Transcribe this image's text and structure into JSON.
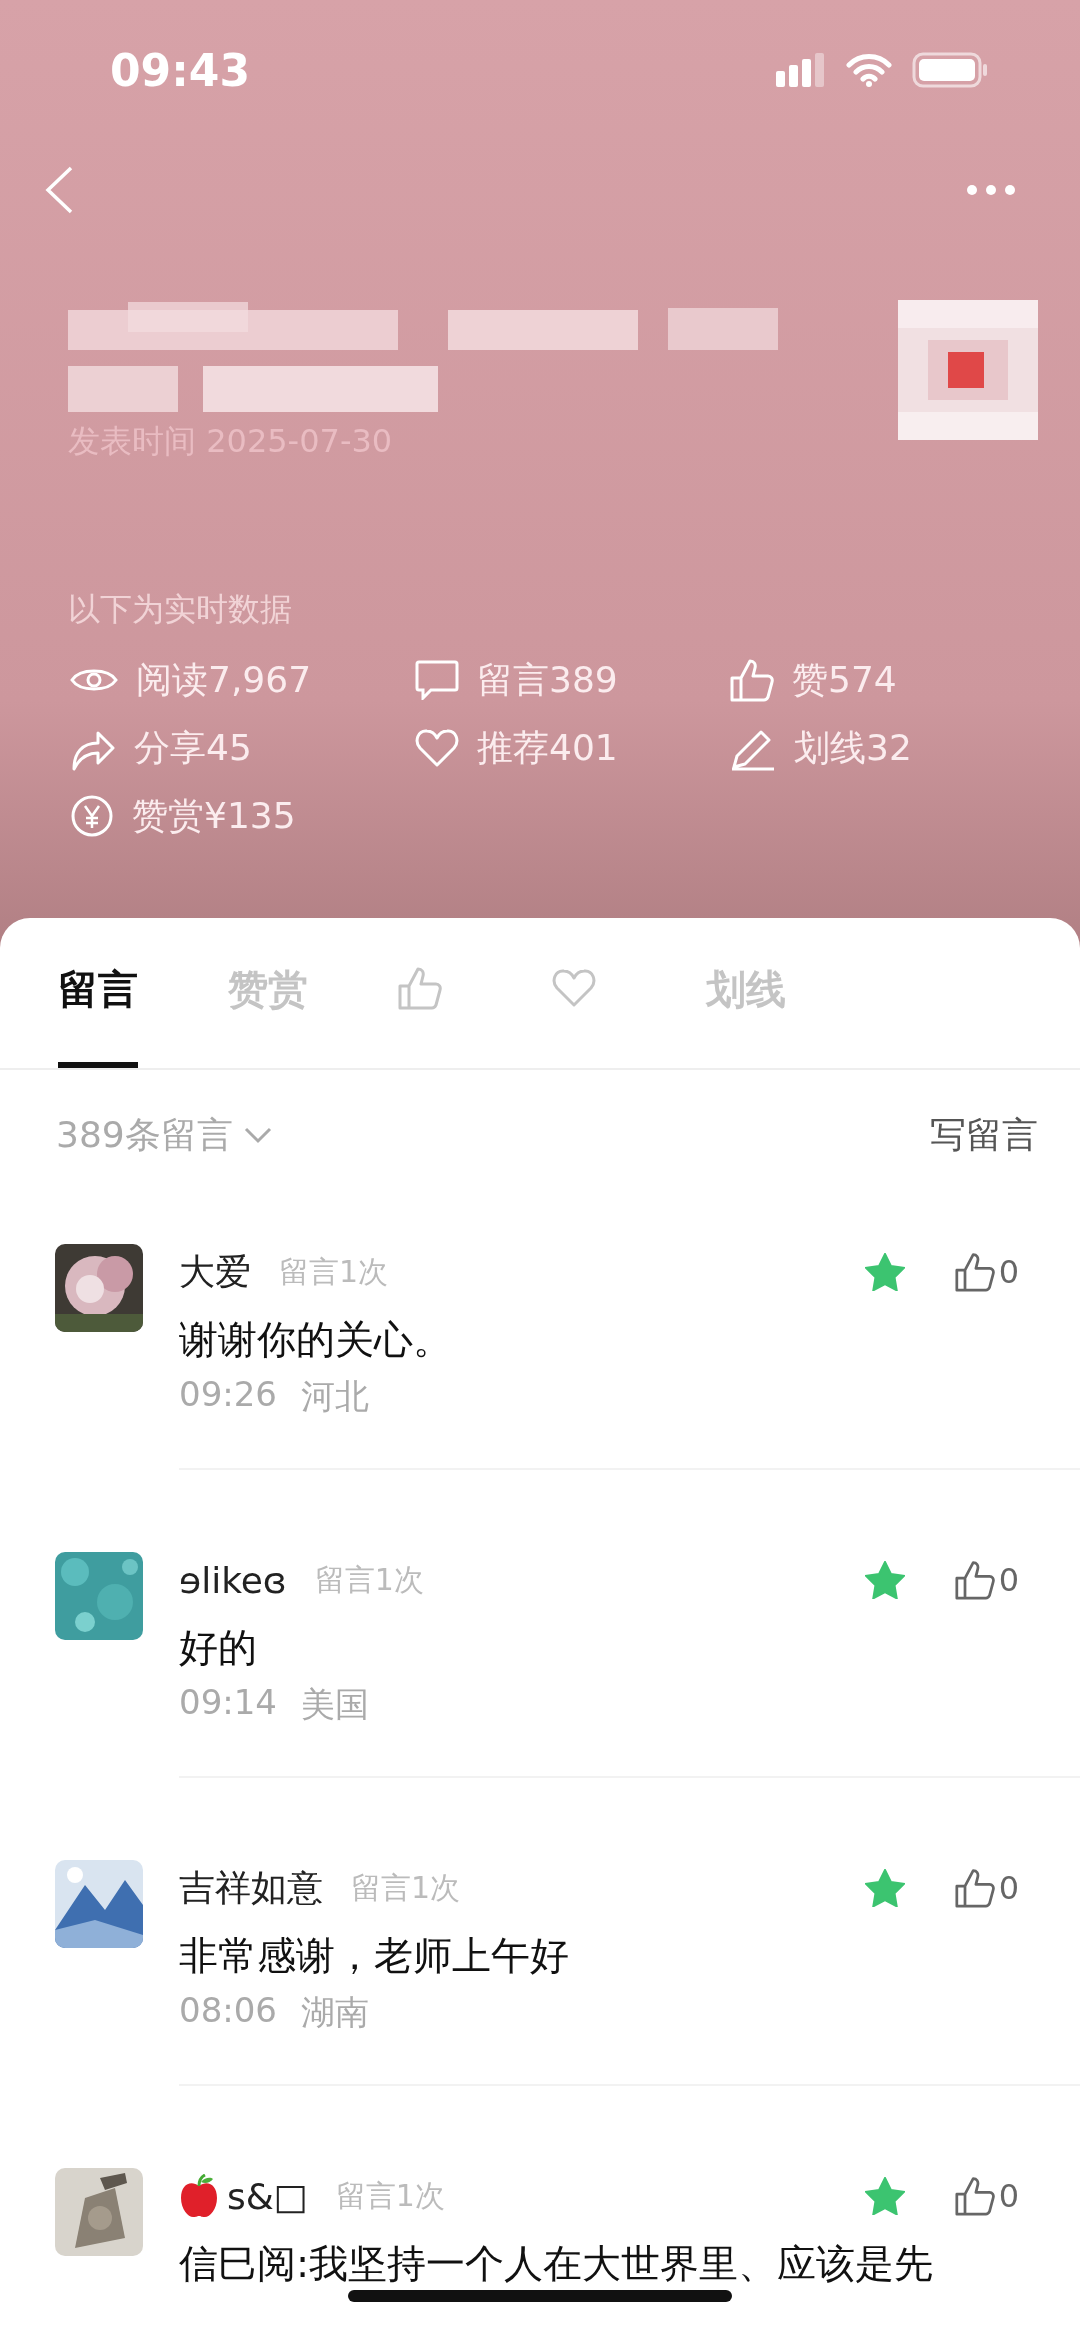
{
  "status_bar": {
    "time": "09:43"
  },
  "article": {
    "published": "发表时间 2025-07-30"
  },
  "realtime_label": "以下为实时数据",
  "stats": [
    {
      "kind": "eye",
      "label": "阅读7,967"
    },
    {
      "kind": "comment",
      "label": "留言389"
    },
    {
      "kind": "like",
      "label": "赞574"
    },
    {
      "kind": "share",
      "label": "分享45"
    },
    {
      "kind": "heart",
      "label": "推荐401"
    },
    {
      "kind": "pen",
      "label": "划线32"
    },
    {
      "kind": "yuan",
      "label": "赞赏¥135"
    }
  ],
  "tabs": [
    {
      "kind": "text",
      "label": "留言",
      "selected": true
    },
    {
      "kind": "text",
      "label": "赞赏",
      "selected": false
    },
    {
      "kind": "like",
      "selected": false
    },
    {
      "kind": "heart",
      "selected": false
    },
    {
      "kind": "text",
      "label": "划线",
      "selected": false
    }
  ],
  "comment_bar": {
    "count": "389条留言",
    "write": "写留言"
  },
  "comments": [
    {
      "name": "大爱",
      "count": "留言1次",
      "text": "谢谢你的关心。",
      "time": "09:26",
      "location": "河北",
      "starred": true,
      "likes": "0"
    },
    {
      "name": "ɘlikeɞ",
      "count": "留言1次",
      "text": "好的",
      "time": "09:14",
      "location": "美国",
      "starred": true,
      "likes": "0"
    },
    {
      "name": "吉祥如意",
      "count": "留言1次",
      "text": "非常感谢，老师上午好",
      "time": "08:06",
      "location": "湖南",
      "starred": true,
      "likes": "0"
    },
    {
      "apple": true,
      "name": "s&□",
      "count": "留言1次",
      "text": "信巳阅:我坚持一个人在大世界里、应该是先",
      "starred": true,
      "likes": "0"
    }
  ]
}
